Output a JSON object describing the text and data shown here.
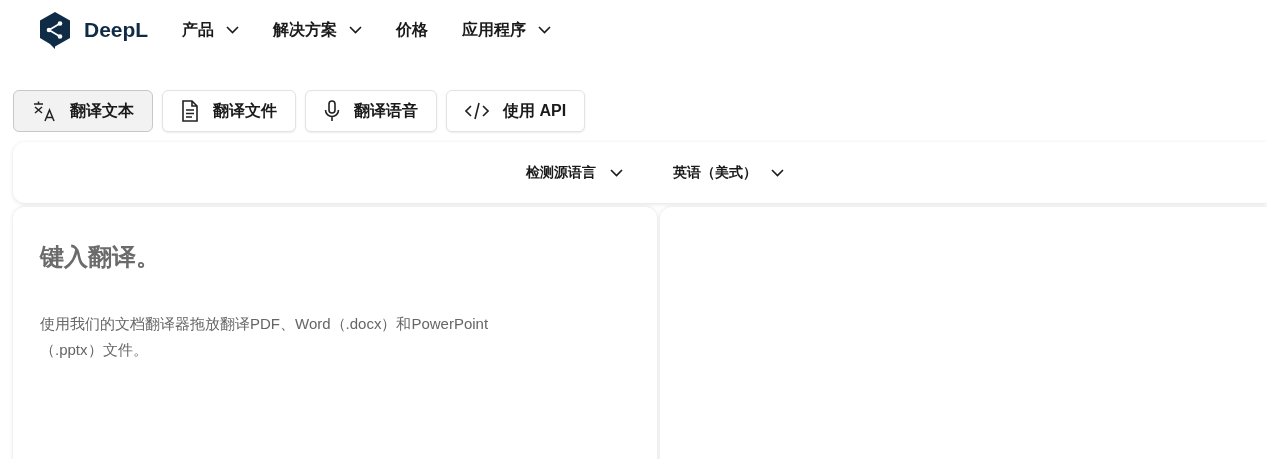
{
  "brand": {
    "name": "DeepL"
  },
  "nav": [
    {
      "label": "产品",
      "dropdown": true
    },
    {
      "label": "解决方案",
      "dropdown": true
    },
    {
      "label": "价格",
      "dropdown": false
    },
    {
      "label": "应用程序",
      "dropdown": true
    }
  ],
  "tabs": [
    {
      "label": "翻译文本",
      "selected": true
    },
    {
      "label": "翻译文件",
      "selected": false
    },
    {
      "label": "翻译语音",
      "selected": false
    },
    {
      "label": "使用 API",
      "selected": false
    }
  ],
  "languages": {
    "source": "检测源语言",
    "target": "英语（美式）"
  },
  "source_panel": {
    "placeholder": "键入翻译。",
    "hint": "使用我们的文档翻译器拖放翻译PDF、Word（.docx）和PowerPoint（.pptx）文件。"
  }
}
